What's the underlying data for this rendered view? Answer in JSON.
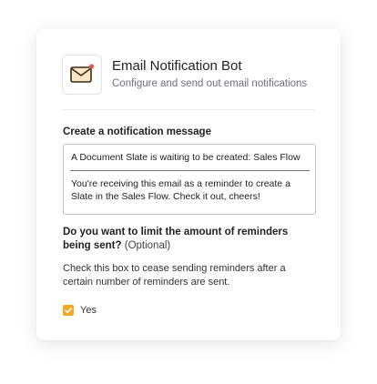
{
  "app": {
    "title": "Email Notification Bot",
    "subtitle": "Configure and send out email notifications",
    "icon": "envelope-icon",
    "icon_color": "#3a2a1a",
    "icon_fill": "#fde6c3",
    "badge_color": "#e65a4a"
  },
  "message": {
    "label": "Create a notification message",
    "subject": "A Document Slate is waiting to be created: Sales Flow",
    "body": "You're receiving this email as a reminder to create a Slate in the Sales Flow. Check it out, cheers!"
  },
  "limit": {
    "question": "Do you want to limit the amount of reminders being sent?",
    "optional": "(Optional)",
    "help": "Check this box to cease sending reminders after a certain number of reminders are sent.",
    "checkbox_label": "Yes",
    "checked": true,
    "checkbox_color": "#f5a623"
  }
}
